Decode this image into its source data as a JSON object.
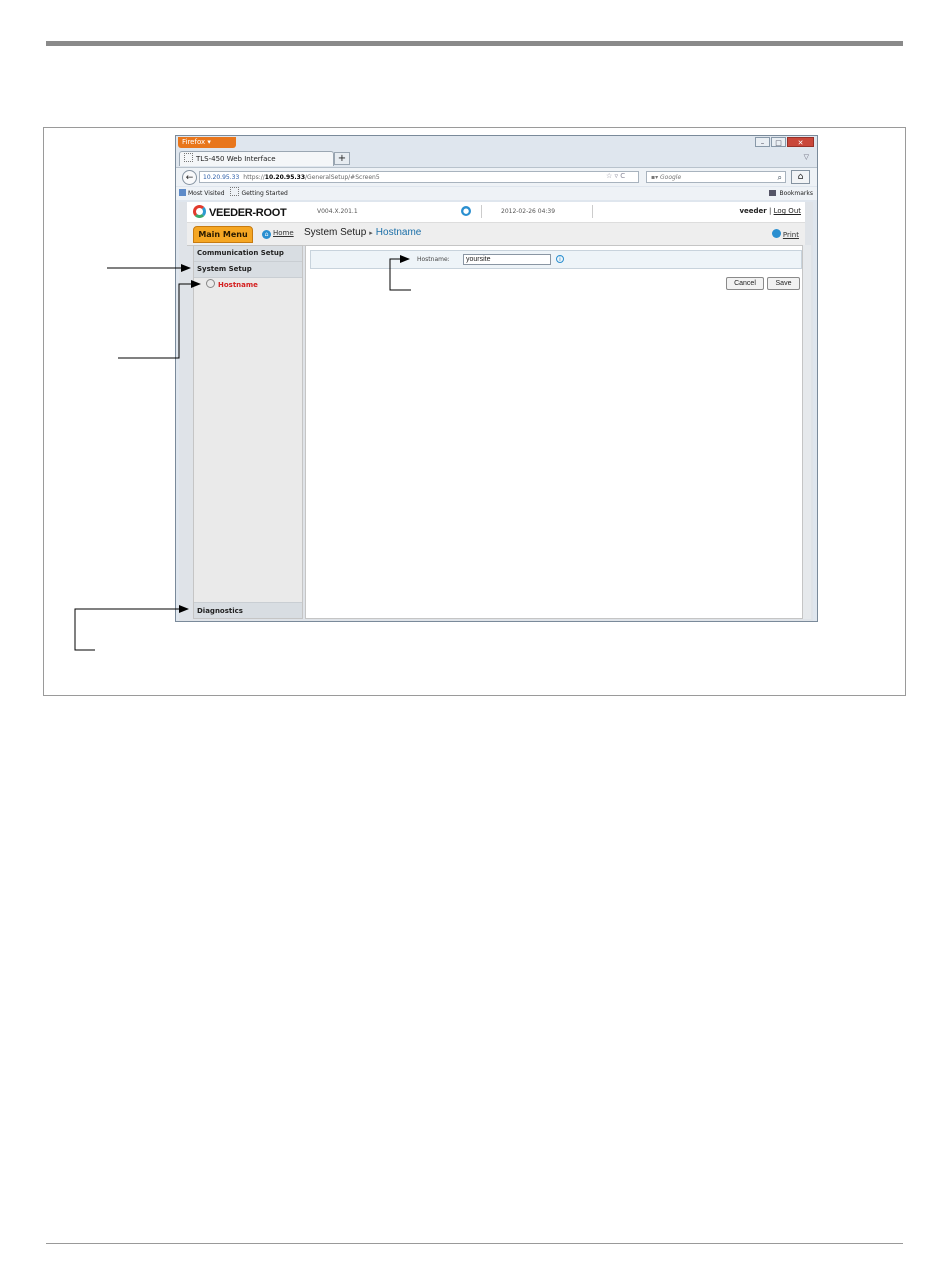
{
  "browser": {
    "menu_button": "Firefox",
    "tab_title": "TLS-450 Web Interface",
    "new_tab": "+",
    "url_site": "10.20.95.33",
    "url_prefix": "https://",
    "url_host": "10.20.95.33",
    "url_path": "/GeneralSetup/#Screen5",
    "search_placeholder": "Google",
    "bookmarks": [
      "Most Visited",
      "Getting Started"
    ],
    "bookmarks_menu": "Bookmarks"
  },
  "app": {
    "logo": "VEEDER-ROOT",
    "version": "V004.X.201.1",
    "datetime": "2012-02-26 04:39",
    "username": "veeder",
    "separator": "|",
    "logout": "Log Out",
    "main_menu": "Main Menu",
    "home": "Home",
    "breadcrumb": {
      "section": "System Setup",
      "separator": "▸",
      "current": "Hostname"
    },
    "print": "Print"
  },
  "sidebar": {
    "sections": [
      "Communication Setup",
      "System Setup"
    ],
    "items": [
      {
        "label": "Hostname",
        "active": true
      }
    ],
    "bottom": "Diagnostics"
  },
  "form": {
    "label": "Hostname:",
    "value": "yoursite",
    "cancel": "Cancel",
    "save": "Save"
  },
  "colors": {
    "accent": "#f5a623",
    "active_item": "#d42020",
    "link_blue": "#1b6fa8"
  }
}
